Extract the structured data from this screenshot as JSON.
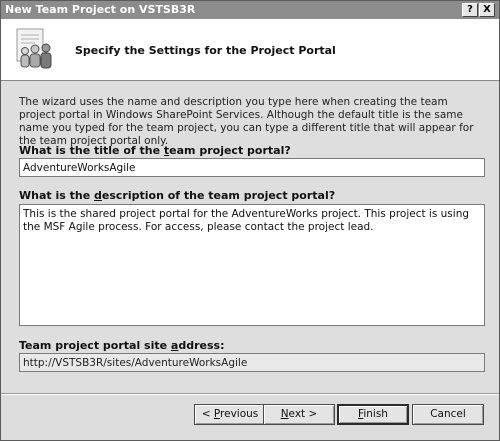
{
  "window": {
    "title": "New Team Project on VSTSB3R",
    "help_button": "?",
    "close_button": "X"
  },
  "header": {
    "title": "Specify the Settings for the Project Portal"
  },
  "intro_text": "The wizard uses the name and description you type here when creating the team project portal in Windows SharePoint Services. Although the default title is the same name you typed for the team project, you can type a different title that will appear for the team project portal only.",
  "title_field": {
    "label_before": "What is the title of the ",
    "label_underlined": "t",
    "label_after": "eam project portal?",
    "value": "AdventureWorksAgile"
  },
  "description_field": {
    "label_before": "What is the ",
    "label_underlined": "d",
    "label_after": "escription of the team project portal?",
    "value": "This is the shared project portal for the AdventureWorks project. This project is using the MSF Agile process. For access, please contact the project lead."
  },
  "address_field": {
    "label_before": "Team project portal site ",
    "label_underlined": "a",
    "label_after": "ddress:",
    "value": "http://VSTSB3R/sites/AdventureWorksAgile"
  },
  "buttons": {
    "previous": {
      "prefix": "< ",
      "underlined": "P",
      "rest": "revious"
    },
    "next": {
      "underlined": "N",
      "rest": "ext >"
    },
    "finish": {
      "underlined": "F",
      "rest": "inish"
    },
    "cancel": "Cancel"
  }
}
